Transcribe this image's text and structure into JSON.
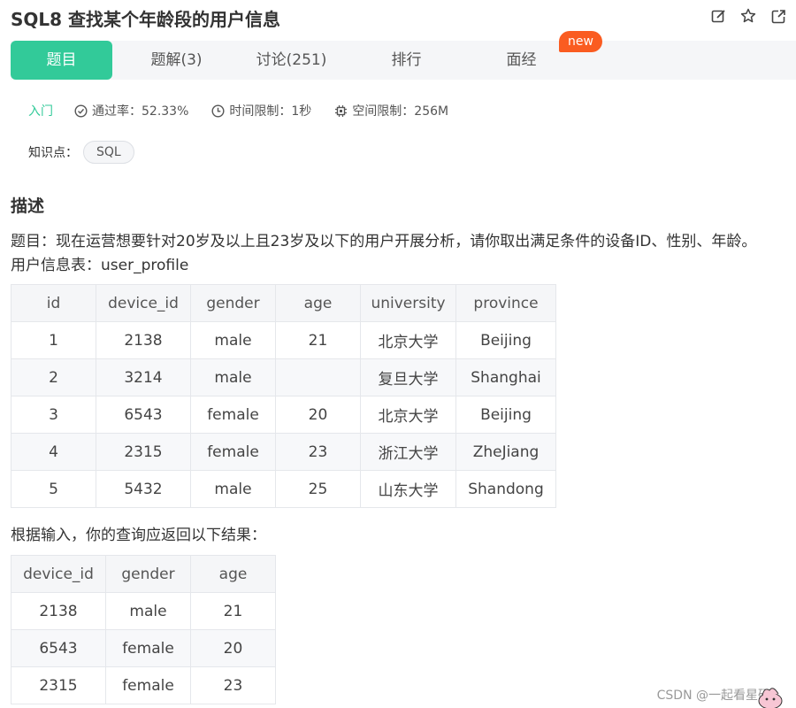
{
  "header": {
    "title": "SQL8  查找某个年龄段的用户信息",
    "icons": [
      "edit-icon",
      "star-icon",
      "share-icon"
    ]
  },
  "tabs": [
    {
      "label": "题目",
      "active": true
    },
    {
      "label": "题解(3)",
      "active": false
    },
    {
      "label": "讨论(251)",
      "active": false
    },
    {
      "label": "排行",
      "active": false
    },
    {
      "label": "面经",
      "active": false
    }
  ],
  "new_badge": "new",
  "meta": {
    "level": "入门",
    "pass_rate": "通过率：52.33%",
    "time_limit": "时间限制：1秒",
    "space_limit": "空间限制：256M"
  },
  "knowledge": {
    "label": "知识点：",
    "tag": "SQL"
  },
  "description": {
    "heading": "描述",
    "line1": "题目：现在运营想要针对20岁及以上且23岁及以下的用户开展分析，请你取出满足条件的设备ID、性别、年龄。",
    "line2": "用户信息表：user_profile",
    "result_intro": "根据输入，你的查询应返回以下结果："
  },
  "user_profile_table": {
    "headers": [
      "id",
      "device_id",
      "gender",
      "age",
      "university",
      "province"
    ],
    "rows": [
      [
        "1",
        "2138",
        "male",
        "21",
        "北京大学",
        "Beijing"
      ],
      [
        "2",
        "3214",
        "male",
        "",
        "复旦大学",
        "Shanghai"
      ],
      [
        "3",
        "6543",
        "female",
        "20",
        "北京大学",
        "Beijing"
      ],
      [
        "4",
        "2315",
        "female",
        "23",
        "浙江大学",
        "ZheJiang"
      ],
      [
        "5",
        "5432",
        "male",
        "25",
        "山东大学",
        "Shandong"
      ]
    ]
  },
  "result_table": {
    "headers": [
      "device_id",
      "gender",
      "age"
    ],
    "rows": [
      [
        "2138",
        "male",
        "21"
      ],
      [
        "6543",
        "female",
        "20"
      ],
      [
        "2315",
        "female",
        "23"
      ]
    ]
  },
  "watermark": "CSDN @一起看星码_",
  "colors": {
    "accent": "#32ca99",
    "badge": "#fa5c21",
    "tab_bg": "#f5f6f8"
  }
}
